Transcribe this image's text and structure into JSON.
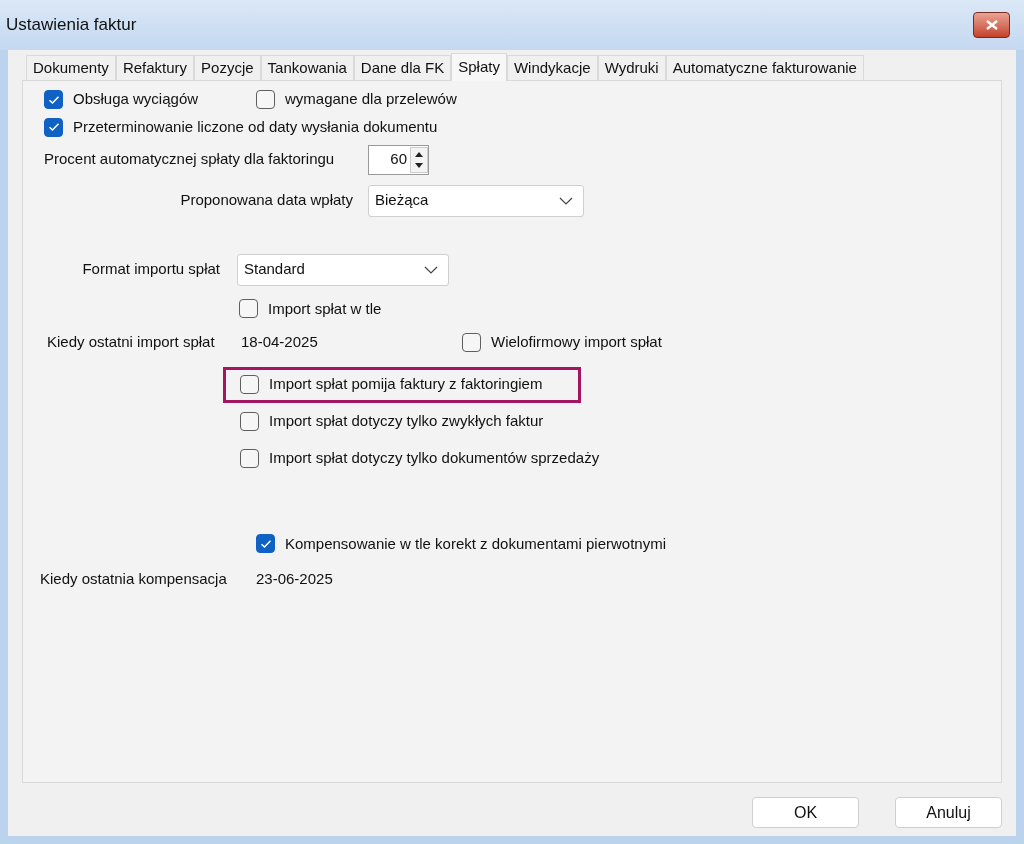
{
  "window": {
    "title": "Ustawienia faktur"
  },
  "tabs": [
    {
      "label": "Dokumenty",
      "selected": false
    },
    {
      "label": "Refaktury",
      "selected": false
    },
    {
      "label": "Pozycje",
      "selected": false
    },
    {
      "label": "Tankowania",
      "selected": false
    },
    {
      "label": "Dane dla FK",
      "selected": false
    },
    {
      "label": "Spłaty",
      "selected": true
    },
    {
      "label": "Windykacje",
      "selected": false
    },
    {
      "label": "Wydruki",
      "selected": false
    },
    {
      "label": "Automatyczne fakturowanie",
      "selected": false
    }
  ],
  "statements": {
    "handling": {
      "label": "Obsługa wyciągów",
      "checked": true
    },
    "required_for_transfers": {
      "label": "wymagane dla przelewów",
      "checked": false
    }
  },
  "overdue_from_send_date": {
    "label": "Przeterminowanie liczone od daty wysłania dokumentu",
    "checked": true
  },
  "factoring_percent": {
    "label": "Procent automatycznej spłaty dla faktoringu",
    "value": "60"
  },
  "proposed_payment_date": {
    "label": "Proponowana data wpłaty",
    "value": "Bieżąca"
  },
  "import_format": {
    "label": "Format importu spłat",
    "value": "Standard"
  },
  "import_in_background": {
    "label": "Import spłat w tle",
    "checked": false
  },
  "last_import": {
    "label": "Kiedy ostatni import spłat",
    "value": "18-04-2025"
  },
  "multi_company_import": {
    "label": "Wielofirmowy import spłat",
    "checked": false
  },
  "import_options": [
    {
      "label": "Import spłat pomija faktury z faktoringiem",
      "checked": false,
      "highlighted": true
    },
    {
      "label": "Import spłat dotyczy tylko zwykłych faktur",
      "checked": false,
      "highlighted": false
    },
    {
      "label": "Import spłat dotyczy tylko dokumentów sprzedaży",
      "checked": false,
      "highlighted": false
    }
  ],
  "background_compensation": {
    "label": "Kompensowanie w tle korekt z dokumentami pierwotnymi",
    "checked": true
  },
  "last_compensation": {
    "label": "Kiedy ostatnia kompensacja",
    "value": "23-06-2025"
  },
  "buttons": [
    "OK",
    "Anuluj"
  ]
}
